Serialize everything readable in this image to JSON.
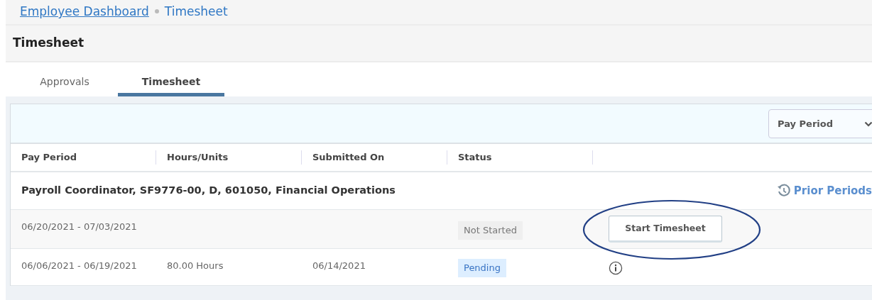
{
  "breadcrumb": [
    {
      "label": "Employee Dashboard",
      "kind": "link"
    },
    {
      "label": "Timesheet",
      "kind": "current"
    }
  ],
  "page_title": "Timesheet",
  "tabs": [
    {
      "label": "Approvals",
      "selected": false
    },
    {
      "label": "Timesheet",
      "selected": true
    }
  ],
  "filter": {
    "value": "Pay Period"
  },
  "table": {
    "columns": [
      "Pay Period",
      "Hours/Units",
      "Submitted On",
      "Status"
    ],
    "group": {
      "title": "Payroll Coordinator, SF9776-00, D, 601050, Financial Operations",
      "link": "Prior Periods"
    },
    "rows": [
      {
        "pay_period": "06/20/2021 - 07/03/2021",
        "status": {
          "label": "Not Started",
          "kind": "neutral"
        },
        "action": {
          "kind": "button",
          "label": "Start Timesheet"
        },
        "circled": true
      },
      {
        "pay_period": "06/06/2021 - 06/19/2021",
        "hours": "80.00 Hours",
        "submitted_on": "06/14/2021",
        "status": {
          "label": "Pending",
          "kind": "info"
        },
        "action": {
          "kind": "info"
        },
        "circled": false
      }
    ]
  }
}
